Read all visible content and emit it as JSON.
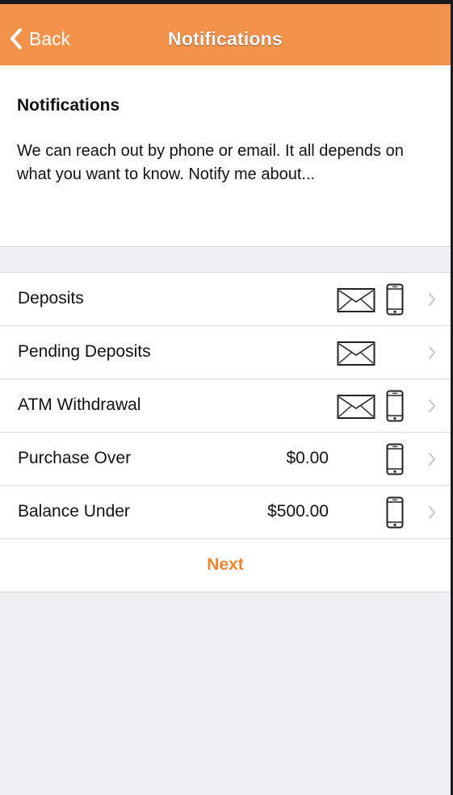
{
  "navbar": {
    "back_label": "Back",
    "title": "Notifications"
  },
  "intro": {
    "heading": "Notifications",
    "description": "We can reach out by phone or email. It all depends on what you want to know. Notify me about..."
  },
  "rows": [
    {
      "label": "Deposits",
      "amount": "",
      "email": true,
      "phone": true
    },
    {
      "label": "Pending Deposits",
      "amount": "",
      "email": true,
      "phone": false
    },
    {
      "label": "ATM Withdrawal",
      "amount": "",
      "email": true,
      "phone": true
    },
    {
      "label": "Purchase Over",
      "amount": "$0.00",
      "email": false,
      "phone": true
    },
    {
      "label": "Balance Under",
      "amount": "$500.00",
      "email": false,
      "phone": true
    }
  ],
  "next_label": "Next",
  "colors": {
    "accent": "#f3924a",
    "next_text": "#f0862f",
    "background": "#efeff4"
  },
  "icons": {
    "back": "chevron-left-icon",
    "email": "envelope-icon",
    "phone": "mobile-phone-icon",
    "disclosure": "chevron-right-icon"
  }
}
